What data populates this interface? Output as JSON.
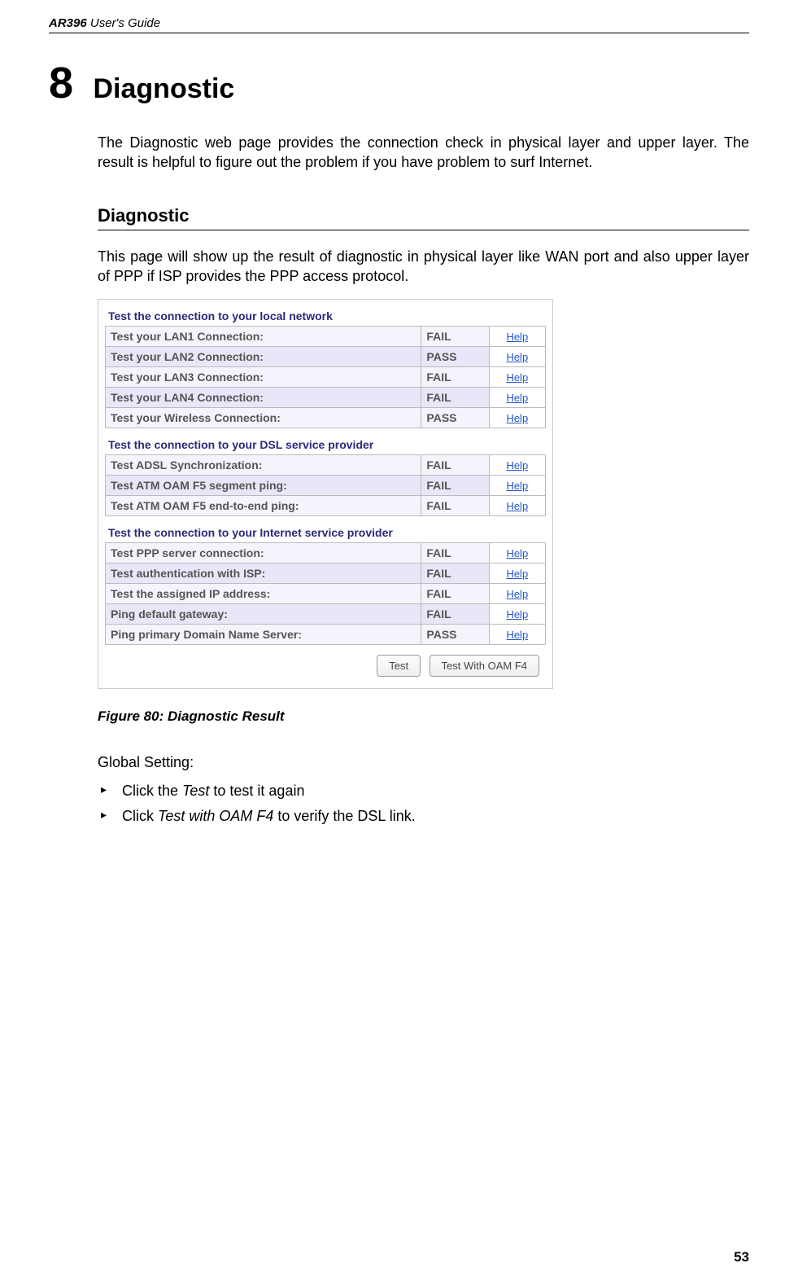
{
  "header": {
    "product": "AR396",
    "suffix": " User's Guide"
  },
  "chapter": {
    "number": "8",
    "title": "Diagnostic"
  },
  "intro_para": "The Diagnostic web page provides the connection check in physical layer and upper layer. The result is helpful to figure out the problem if you have problem to surf Internet.",
  "section_heading": "Diagnostic",
  "section_para": "This page will show up the result of diagnostic in physical layer like WAN port and also upper layer of PPP if ISP provides the PPP access protocol.",
  "diag": {
    "help_label": "Help",
    "groups": [
      {
        "title": "Test the connection to your local network",
        "rows": [
          {
            "label": "Test your LAN1 Connection:",
            "status": "FAIL"
          },
          {
            "label": "Test your LAN2 Connection:",
            "status": "PASS"
          },
          {
            "label": "Test your LAN3 Connection:",
            "status": "FAIL"
          },
          {
            "label": "Test your LAN4 Connection:",
            "status": "FAIL"
          },
          {
            "label": "Test your Wireless Connection:",
            "status": "PASS"
          }
        ]
      },
      {
        "title": "Test the connection to your DSL service provider",
        "rows": [
          {
            "label": "Test ADSL Synchronization:",
            "status": "FAIL"
          },
          {
            "label": "Test ATM OAM F5 segment ping:",
            "status": "FAIL"
          },
          {
            "label": "Test ATM OAM F5 end-to-end ping:",
            "status": "FAIL"
          }
        ]
      },
      {
        "title": "Test the connection to your Internet service provider",
        "rows": [
          {
            "label": "Test PPP server connection:",
            "status": "FAIL"
          },
          {
            "label": "Test authentication with ISP:",
            "status": "FAIL"
          },
          {
            "label": "Test the assigned IP address:",
            "status": "FAIL"
          },
          {
            "label": "Ping default gateway:",
            "status": "FAIL"
          },
          {
            "label": "Ping primary Domain Name Server:",
            "status": "PASS"
          }
        ]
      }
    ],
    "buttons": {
      "test": "Test",
      "test_oam": "Test With OAM F4"
    }
  },
  "figure_caption": "Figure 80: Diagnostic Result",
  "global_setting_heading": "Global Setting:",
  "bullets": [
    {
      "prefix": "Click the ",
      "italic": "Test",
      "suffix": " to test it again"
    },
    {
      "prefix": "Click ",
      "italic": "Test with OAM F4",
      "suffix": " to verify the DSL link."
    }
  ],
  "page_number": "53"
}
